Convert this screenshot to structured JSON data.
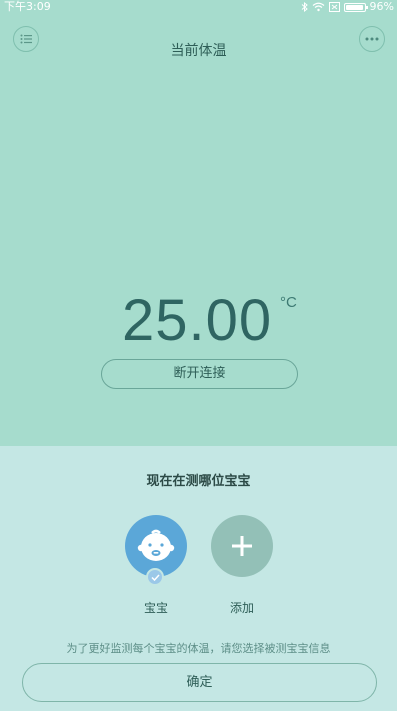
{
  "status_bar": {
    "time": "下午3:09",
    "battery": "96%"
  },
  "header": {
    "title": "当前体温"
  },
  "reading": {
    "value": "25.00",
    "unit": "°C"
  },
  "actions": {
    "disconnect_label": "断开连接"
  },
  "panel": {
    "title": "现在在测哪位宝宝",
    "profiles": [
      {
        "label": "宝宝",
        "selected": true
      },
      {
        "label": "添加"
      }
    ],
    "hint": "为了更好监测每个宝宝的体温，请您选择被测宝宝信息",
    "confirm_label": "确定"
  },
  "colors": {
    "top_background": "#a6dccd",
    "bottom_background": "#c4e7e4",
    "baby_avatar": "#5ba7d8",
    "add_button": "#93c0b7",
    "text_dark": "#2f6562"
  },
  "icons": {
    "menu": "list-icon",
    "more": "more-icon",
    "avatar": "baby-face-icon",
    "add": "plus-icon",
    "selected": "check-icon"
  }
}
